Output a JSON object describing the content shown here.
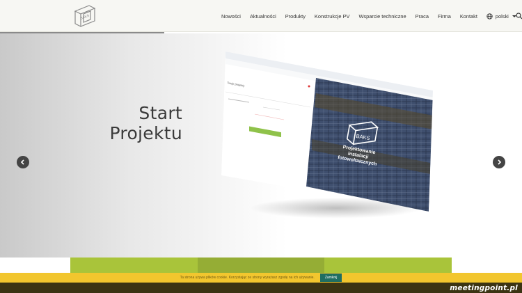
{
  "header": {
    "nav": [
      "Nowości",
      "Aktualności",
      "Produkty",
      "Konstrukcje PV",
      "Wsparcie techniczne",
      "Praca",
      "Firma",
      "Kontakt"
    ],
    "language": "polski"
  },
  "slider": {
    "progress_fraction": 0.315
  },
  "hero": {
    "title_line1": "Start",
    "title_line2": "Projektu",
    "mockup": {
      "tab_title": "Twoje projekty",
      "banner_logo_text": "BAKS",
      "banner_line1": "Projektowanie",
      "banner_line2": "instalacji",
      "banner_line3": "fotowoltaicznych"
    }
  },
  "cookie": {
    "text": "Ta strona używa plików cookie. Korzystając ze strony wyrażasz zgodę na ich używanie.",
    "button": "Zamknij"
  },
  "watermark": "meetingpoint.pl",
  "colors": {
    "accent_green": "#a9c43a",
    "cookie_yellow": "#f2c62e",
    "cookie_button": "#1f6e62",
    "bottom_band": "#3b3413"
  }
}
